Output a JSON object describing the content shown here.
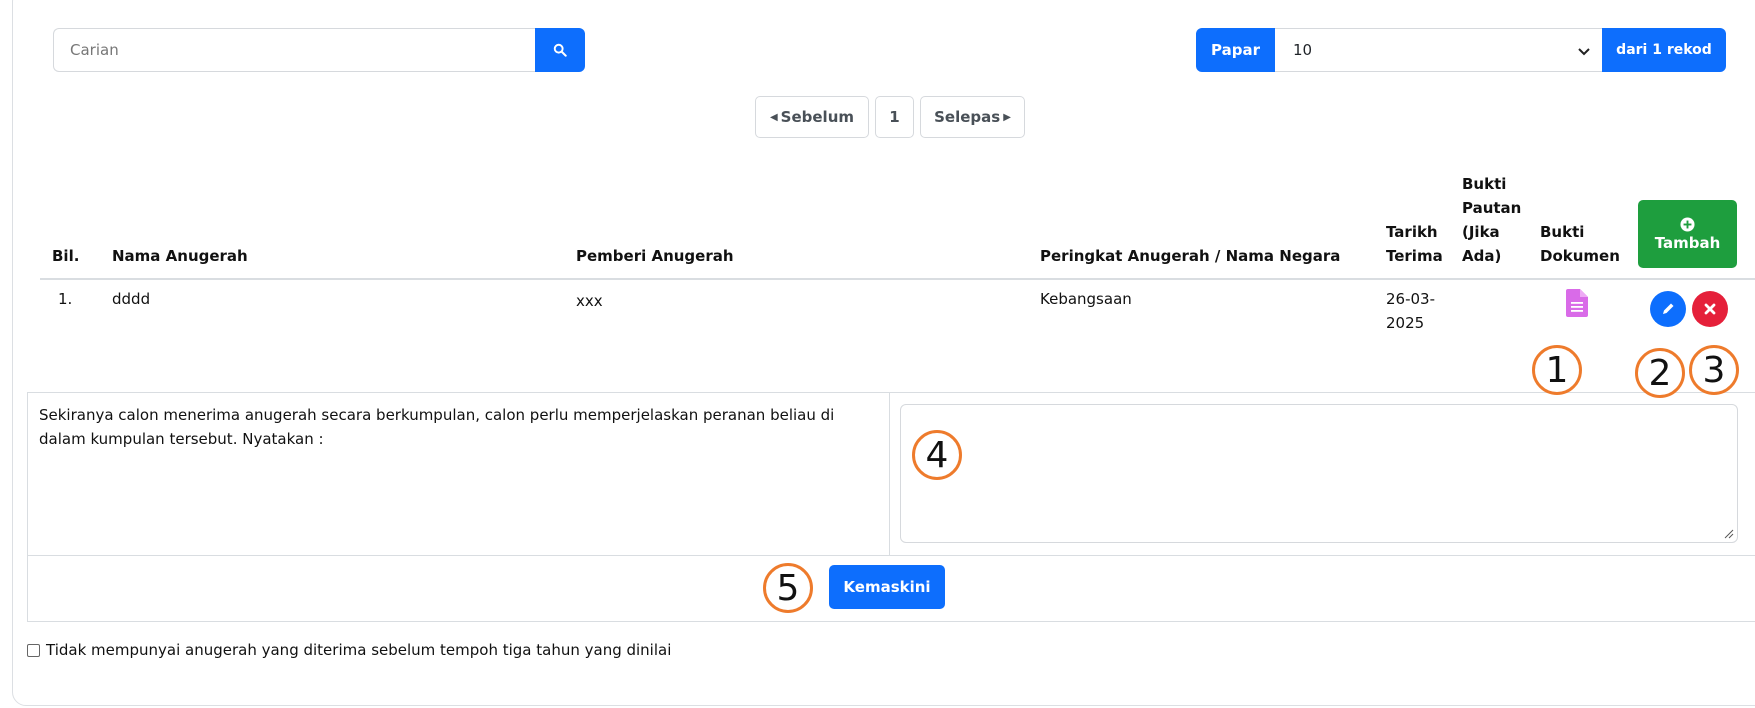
{
  "search": {
    "placeholder": "Carian"
  },
  "display": {
    "label": "Papar",
    "selected": "10",
    "records_label": "dari 1 rekod"
  },
  "pagination": {
    "prev": "Sebelum",
    "current": "1",
    "next": "Selepas"
  },
  "table": {
    "headers": {
      "no": "Bil.",
      "name": "Nama Anugerah",
      "giver": "Pemberi Anugerah",
      "level": "Peringkat Anugerah / Nama Negara",
      "date_l1": "Tarikh",
      "date_l2": "Terima",
      "proof_link_l1": "Bukti",
      "proof_link_l2": "Pautan",
      "proof_link_l3": "(Jika",
      "proof_link_l4": "Ada)",
      "proof_doc_l1": "Bukti",
      "proof_doc_l2": "Dokumen",
      "add_button": "Tambah"
    },
    "rows": [
      {
        "no": "1.",
        "name": "dddd",
        "giver": "xxx",
        "level": "Kebangsaan",
        "date_l1": "26-03-",
        "date_l2": "2025"
      }
    ]
  },
  "callouts": [
    "1",
    "2",
    "3",
    "4",
    "5"
  ],
  "group_note": "Sekiranya calon menerima anugerah secara berkumpulan, calon perlu memperjelaskan peranan beliau di dalam kumpulan tersebut. Nyatakan :",
  "update_button": "Kemaskini",
  "no_award_checkbox_label": "Tidak mempunyai anugerah yang diterima sebelum tempoh tiga tahun yang dinilai",
  "colors": {
    "primary": "#0d6efd",
    "success": "#1e9e3e",
    "danger": "#e5203a",
    "doc": "#d96be8",
    "callout": "#ee7b2c"
  }
}
